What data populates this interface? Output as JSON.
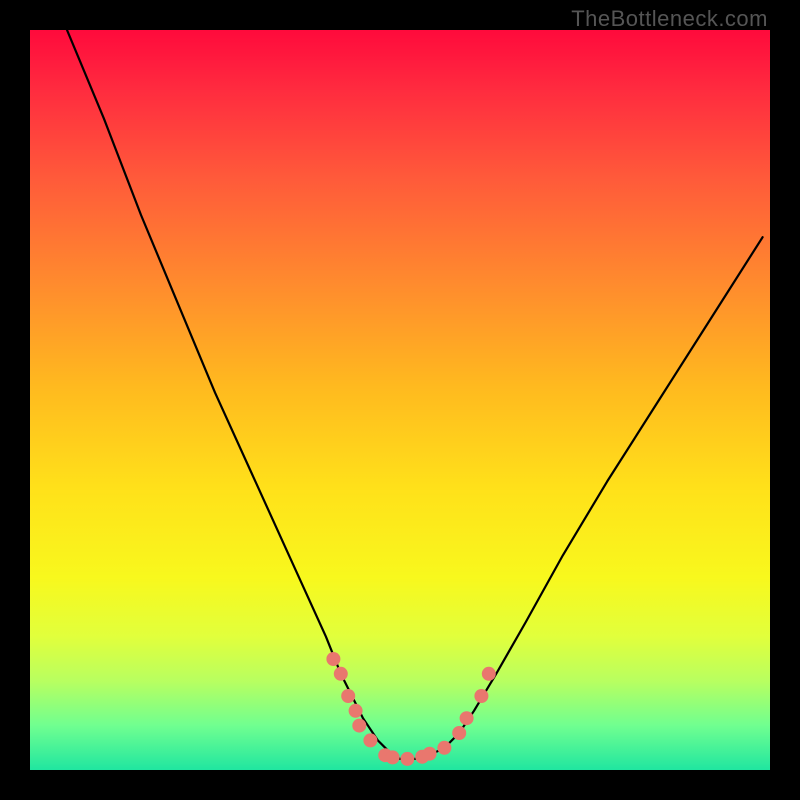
{
  "watermark": "TheBottleneck.com",
  "chart_data": {
    "type": "line",
    "title": "",
    "xlabel": "",
    "ylabel": "",
    "xlim": [
      0,
      100
    ],
    "ylim": [
      0,
      100
    ],
    "grid": false,
    "legend": false,
    "series": [
      {
        "name": "bottleneck-curve",
        "x": [
          5,
          10,
          15,
          20,
          25,
          30,
          35,
          40,
          42,
          45,
          47,
          49,
          50,
          52,
          54,
          56,
          58,
          60,
          63,
          67,
          72,
          78,
          85,
          92,
          99
        ],
        "values": [
          100,
          88,
          75,
          63,
          51,
          40,
          29,
          18,
          13,
          7,
          4,
          2,
          1.5,
          1.5,
          2,
          3,
          5,
          8,
          13,
          20,
          29,
          39,
          50,
          61,
          72
        ]
      }
    ],
    "markers": {
      "name": "highlight-dots",
      "x": [
        41,
        42,
        43,
        44,
        44.5,
        46,
        48,
        49,
        51,
        53,
        54,
        56,
        58,
        59,
        61,
        62
      ],
      "values": [
        15,
        13,
        10,
        8,
        6,
        4,
        2,
        1.7,
        1.5,
        1.8,
        2.2,
        3,
        5,
        7,
        10,
        13
      ]
    },
    "background_gradient": {
      "top": "#ff0a3c",
      "bottom": "#20e6a0"
    }
  }
}
